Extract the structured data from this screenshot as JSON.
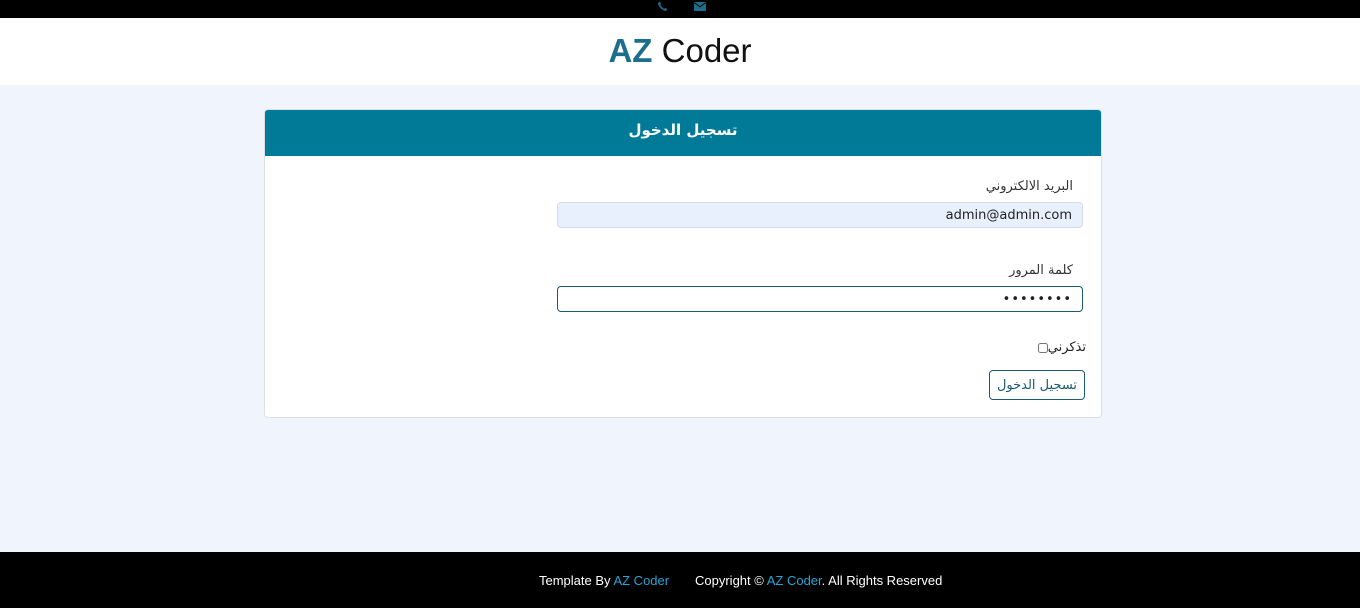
{
  "topbar": {
    "phone_icon": "phone-icon",
    "email_icon": "envelope-icon",
    "icon_color": "#1b6f8c"
  },
  "header": {
    "logo_accent": "AZ",
    "logo_rest": "Coder"
  },
  "login": {
    "title": "تسجيل الدخول",
    "email_label": "البريد الالكتروني",
    "email_value": "admin@admin.com",
    "password_label": "كلمة المرور",
    "password_value": "12345678",
    "remember_label": "تذكرني",
    "remember_checked": false,
    "submit_label": "تسجيل الدخول"
  },
  "footer": {
    "template_prefix": "Template By",
    "template_link": "AZ Coder",
    "copyright_prefix": "Copyright ©",
    "copyright_link": "AZ Coder",
    "copyright_suffix": ". All Rights Reserved"
  },
  "colors": {
    "header_bg": "#017a98",
    "accent": "#1b6f8c",
    "link": "#2aa3d6",
    "page_bg": "#f0f5fd"
  }
}
